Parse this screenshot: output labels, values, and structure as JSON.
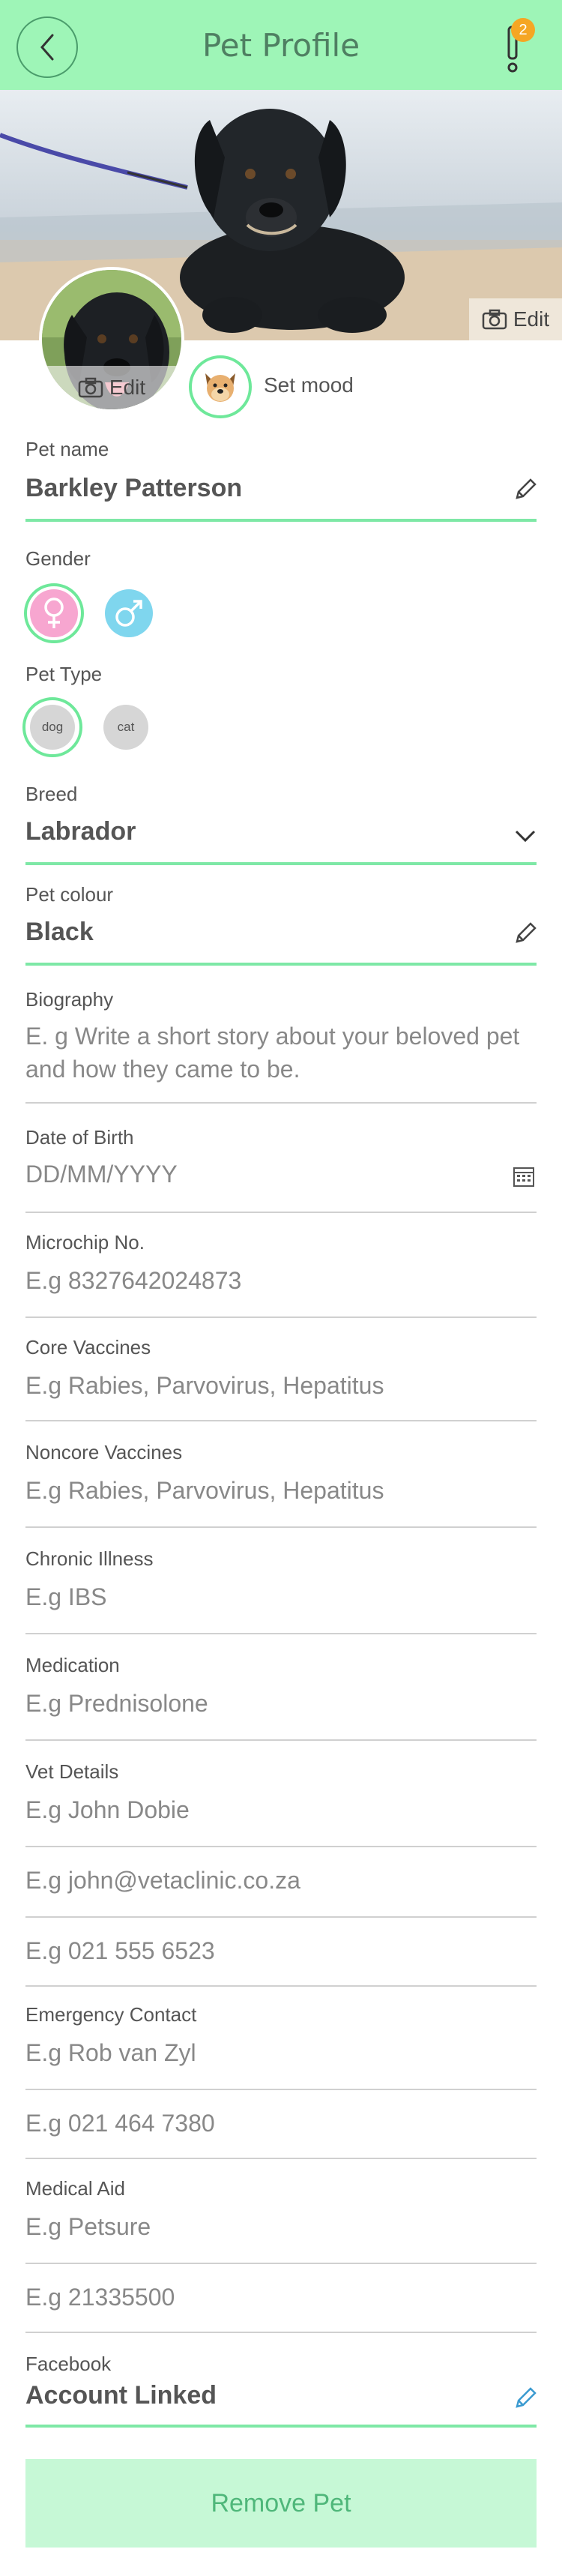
{
  "header": {
    "title": "Pet Profile",
    "notification_count": "2",
    "back_icon": "chevron-left-icon",
    "alert_icon": "exclamation-icon"
  },
  "cover": {
    "edit_label": "Edit"
  },
  "avatar": {
    "edit_label": "Edit"
  },
  "mood": {
    "label": "Set mood",
    "icon": "dog-face-icon"
  },
  "pet_name": {
    "label": "Pet name",
    "value": "Barkley Patterson"
  },
  "gender": {
    "label": "Gender",
    "options": [
      "female",
      "male"
    ],
    "selected": "female"
  },
  "pet_type": {
    "label": "Pet Type",
    "options": [
      "dog",
      "cat"
    ],
    "selected": "dog"
  },
  "breed": {
    "label": "Breed",
    "value": "Labrador"
  },
  "colour": {
    "label": "Pet colour",
    "value": "Black"
  },
  "biography": {
    "label": "Biography",
    "placeholder_line1": "E. g Write a short story about your beloved pet",
    "placeholder_line2": "and how they came to be."
  },
  "dob": {
    "label": "Date of Birth",
    "placeholder": "DD/MM/YYYY"
  },
  "microchip": {
    "label": "Microchip No.",
    "placeholder": "E.g 8327642024873"
  },
  "core_vaccines": {
    "label": "Core Vaccines",
    "placeholder": "E.g Rabies, Parvovirus, Hepatitus"
  },
  "noncore_vaccines": {
    "label": "Noncore Vaccines",
    "placeholder": "E.g Rabies, Parvovirus, Hepatitus"
  },
  "chronic_illness": {
    "label": "Chronic Illness",
    "placeholder": "E.g IBS"
  },
  "medication": {
    "label": "Medication",
    "placeholder": "E.g Prednisolone"
  },
  "vet": {
    "label": "Vet Details",
    "name_placeholder": "E.g John Dobie",
    "email_placeholder": "E.g john@vetaclinic.co.za",
    "phone_placeholder": "E.g 021 555 6523"
  },
  "emergency": {
    "label": "Emergency Contact",
    "name_placeholder": "E.g Rob van Zyl",
    "phone_placeholder": "E.g 021 464 7380"
  },
  "medical_aid": {
    "label": "Medical Aid",
    "name_placeholder": "E.g Petsure",
    "number_placeholder": "E.g 21335500"
  },
  "facebook": {
    "label": "Facebook",
    "value": "Account Linked"
  },
  "remove_button": {
    "label": "Remove Pet"
  },
  "colors": {
    "accent": "#9ef5b7",
    "line": "#7ee8a6",
    "female": "#f7a6d0",
    "male": "#7fd6ee"
  }
}
